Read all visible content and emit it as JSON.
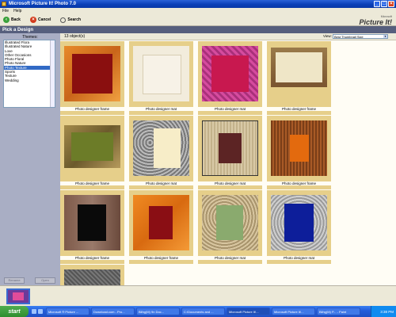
{
  "window": {
    "title": "Microsoft Picture It! Photo 7.0"
  },
  "menu": [
    "File",
    "Help"
  ],
  "toolbar": {
    "back": "Back",
    "cancel": "Cancel",
    "search": "Search"
  },
  "brand": {
    "small": "Microsoft",
    "big": "Picture It!"
  },
  "header": {
    "title": "Pick a Design"
  },
  "themes": {
    "label": "Themes:",
    "items": [
      "Illustrated Flora",
      "Illustrated Nature",
      "Love",
      "Other Occasions",
      "Photo Floral",
      "Photo Nature",
      "Photo Texture",
      "Sports",
      "Texture",
      "Wedding"
    ],
    "selected": "Photo Texture"
  },
  "left_buttons": {
    "rename": "Rename",
    "open": "Open"
  },
  "main": {
    "count": "13 object(s)",
    "view_label": "View:",
    "view_value": "Best Thumbnail Size",
    "thumbnails": [
      {
        "caption": "Photo designer frame"
      },
      {
        "caption": "Photo designer mat"
      },
      {
        "caption": "Photo designer mat"
      },
      {
        "caption": "Photo designer frame"
      },
      {
        "caption": "Photo designer frame"
      },
      {
        "caption": "Photo designer mat"
      },
      {
        "caption": "Photo designer mat"
      },
      {
        "caption": "Photo designer frame"
      },
      {
        "caption": "Photo designer frame"
      },
      {
        "caption": "Photo designer frame"
      },
      {
        "caption": "Photo designer mat"
      },
      {
        "caption": "Photo designer mat"
      },
      {
        "caption": ""
      }
    ]
  },
  "taskbar": {
    "start": "start",
    "tasks": [
      "Microsoft ® Picture ...",
      "Download.com - Pro...",
      "Bilhg(M) 9n Doc...",
      "C:\\Documents and ...",
      "Microsoft Picture It!...",
      "Microsoft Picture It!...",
      "Bilhg(M) P... - Paint"
    ],
    "clock": "3:38 PM"
  }
}
